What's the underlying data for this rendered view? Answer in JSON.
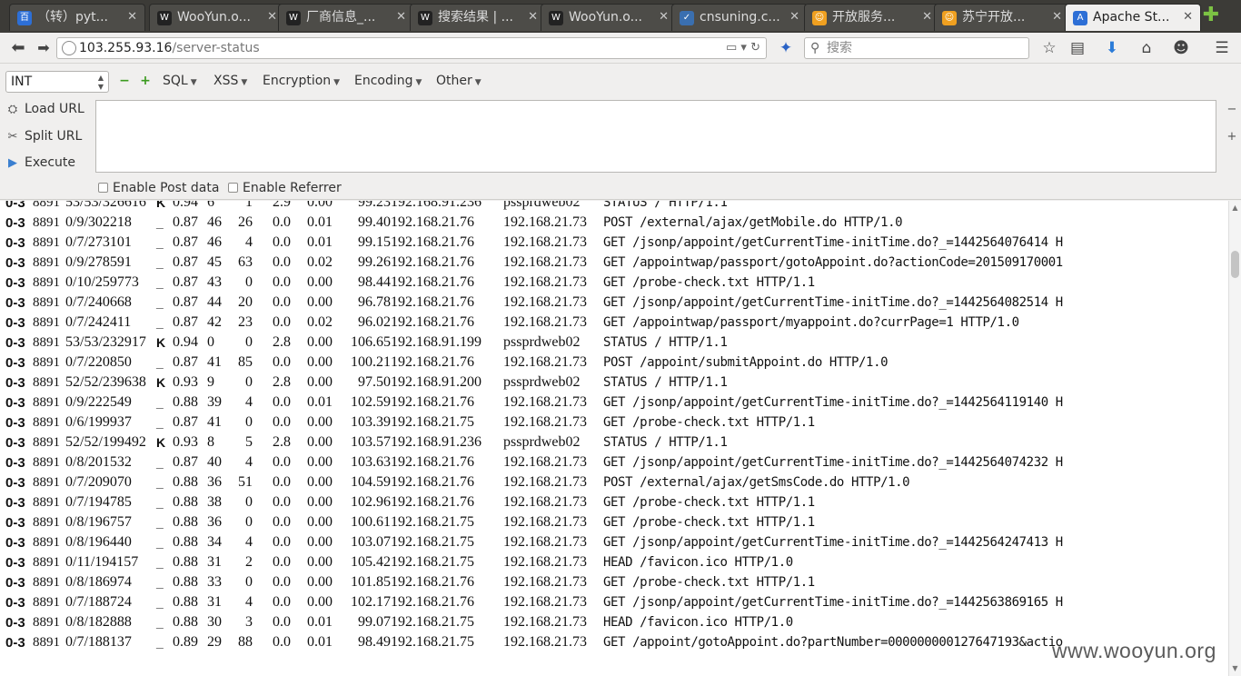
{
  "tabs": [
    {
      "title": "（转）pyt...",
      "icon": "baidu-icon",
      "color": "#2d6fd6",
      "glyph": "百"
    },
    {
      "title": "WooYun.o...",
      "icon": "wooyun-icon",
      "color": "#222222",
      "glyph": "W"
    },
    {
      "title": "厂商信息_...",
      "icon": "wooyun-icon",
      "color": "#222222",
      "glyph": "W"
    },
    {
      "title": "搜索结果 | ...",
      "icon": "wooyun-icon",
      "color": "#222222",
      "glyph": "W"
    },
    {
      "title": "WooYun.o...",
      "icon": "wooyun-icon",
      "color": "#222222",
      "glyph": "W"
    },
    {
      "title": "cnsuning.c...",
      "icon": "cnsuning-icon",
      "color": "#3a6fb0",
      "glyph": "✓"
    },
    {
      "title": "开放服务...",
      "icon": "suning-icon",
      "color": "#f0a020",
      "glyph": "☺"
    },
    {
      "title": "苏宁开放...",
      "icon": "suning-icon",
      "color": "#f0a020",
      "glyph": "☺"
    },
    {
      "title": "Apache St...",
      "icon": "apache-status-icon",
      "color": "#2d6fd6",
      "glyph": "A",
      "active": true
    }
  ],
  "nav": {
    "url_host": "103.255.93.16",
    "url_path": "/server-status",
    "search_placeholder": "搜索"
  },
  "hackbar": {
    "select_value": "INT",
    "menus": [
      "SQL",
      "XSS",
      "Encryption",
      "Encoding",
      "Other"
    ],
    "load_url": "Load URL",
    "split_url": "Split URL",
    "execute": "Execute",
    "enable_post": "Enable Post data",
    "enable_referrer": "Enable Referrer"
  },
  "rows": [
    [
      "0-3",
      "8891",
      "53/53/326616",
      "K",
      "0.94",
      "6",
      "1",
      "2.9",
      "0.00",
      "99.23",
      "192.168.91.236",
      "pssprdweb02",
      "STATUS / HTTP/1.1"
    ],
    [
      "0-3",
      "8891",
      "0/9/302218",
      "_",
      "0.87",
      "46",
      "26",
      "0.0",
      "0.01",
      "99.40",
      "192.168.21.76",
      "192.168.21.73",
      "POST /external/ajax/getMobile.do HTTP/1.0"
    ],
    [
      "0-3",
      "8891",
      "0/7/273101",
      "_",
      "0.87",
      "46",
      "4",
      "0.0",
      "0.01",
      "99.15",
      "192.168.21.76",
      "192.168.21.73",
      "GET /jsonp/appoint/getCurrentTime-initTime.do?_=1442564076414 H"
    ],
    [
      "0-3",
      "8891",
      "0/9/278591",
      "_",
      "0.87",
      "45",
      "63",
      "0.0",
      "0.02",
      "99.26",
      "192.168.21.76",
      "192.168.21.73",
      "GET /appointwap/passport/gotoAppoint.do?actionCode=201509170001"
    ],
    [
      "0-3",
      "8891",
      "0/10/259773",
      "_",
      "0.87",
      "43",
      "0",
      "0.0",
      "0.00",
      "98.44",
      "192.168.21.76",
      "192.168.21.73",
      "GET /probe-check.txt HTTP/1.1"
    ],
    [
      "0-3",
      "8891",
      "0/7/240668",
      "_",
      "0.87",
      "44",
      "20",
      "0.0",
      "0.00",
      "96.78",
      "192.168.21.76",
      "192.168.21.73",
      "GET /jsonp/appoint/getCurrentTime-initTime.do?_=1442564082514 H"
    ],
    [
      "0-3",
      "8891",
      "0/7/242411",
      "_",
      "0.87",
      "42",
      "23",
      "0.0",
      "0.02",
      "96.02",
      "192.168.21.76",
      "192.168.21.73",
      "GET /appointwap/passport/myappoint.do?currPage=1 HTTP/1.0"
    ],
    [
      "0-3",
      "8891",
      "53/53/232917",
      "K",
      "0.94",
      "0",
      "0",
      "2.8",
      "0.00",
      "106.65",
      "192.168.91.199",
      "pssprdweb02",
      "STATUS / HTTP/1.1"
    ],
    [
      "0-3",
      "8891",
      "0/7/220850",
      "_",
      "0.87",
      "41",
      "85",
      "0.0",
      "0.00",
      "100.21",
      "192.168.21.76",
      "192.168.21.73",
      "POST /appoint/submitAppoint.do HTTP/1.0"
    ],
    [
      "0-3",
      "8891",
      "52/52/239638",
      "K",
      "0.93",
      "9",
      "0",
      "2.8",
      "0.00",
      "97.50",
      "192.168.91.200",
      "pssprdweb02",
      "STATUS / HTTP/1.1"
    ],
    [
      "0-3",
      "8891",
      "0/9/222549",
      "_",
      "0.88",
      "39",
      "4",
      "0.0",
      "0.01",
      "102.59",
      "192.168.21.76",
      "192.168.21.73",
      "GET /jsonp/appoint/getCurrentTime-initTime.do?_=1442564119140 H"
    ],
    [
      "0-3",
      "8891",
      "0/6/199937",
      "_",
      "0.87",
      "41",
      "0",
      "0.0",
      "0.00",
      "103.39",
      "192.168.21.75",
      "192.168.21.73",
      "GET /probe-check.txt HTTP/1.1"
    ],
    [
      "0-3",
      "8891",
      "52/52/199492",
      "K",
      "0.93",
      "8",
      "5",
      "2.8",
      "0.00",
      "103.57",
      "192.168.91.236",
      "pssprdweb02",
      "STATUS / HTTP/1.1"
    ],
    [
      "0-3",
      "8891",
      "0/8/201532",
      "_",
      "0.87",
      "40",
      "4",
      "0.0",
      "0.00",
      "103.63",
      "192.168.21.76",
      "192.168.21.73",
      "GET /jsonp/appoint/getCurrentTime-initTime.do?_=1442564074232 H"
    ],
    [
      "0-3",
      "8891",
      "0/7/209070",
      "_",
      "0.88",
      "36",
      "51",
      "0.0",
      "0.00",
      "104.59",
      "192.168.21.76",
      "192.168.21.73",
      "POST /external/ajax/getSmsCode.do HTTP/1.0"
    ],
    [
      "0-3",
      "8891",
      "0/7/194785",
      "_",
      "0.88",
      "38",
      "0",
      "0.0",
      "0.00",
      "102.96",
      "192.168.21.76",
      "192.168.21.73",
      "GET /probe-check.txt HTTP/1.1"
    ],
    [
      "0-3",
      "8891",
      "0/8/196757",
      "_",
      "0.88",
      "36",
      "0",
      "0.0",
      "0.00",
      "100.61",
      "192.168.21.75",
      "192.168.21.73",
      "GET /probe-check.txt HTTP/1.1"
    ],
    [
      "0-3",
      "8891",
      "0/8/196440",
      "_",
      "0.88",
      "34",
      "4",
      "0.0",
      "0.00",
      "103.07",
      "192.168.21.75",
      "192.168.21.73",
      "GET /jsonp/appoint/getCurrentTime-initTime.do?_=1442564247413 H"
    ],
    [
      "0-3",
      "8891",
      "0/11/194157",
      "_",
      "0.88",
      "31",
      "2",
      "0.0",
      "0.00",
      "105.42",
      "192.168.21.75",
      "192.168.21.73",
      "HEAD /favicon.ico HTTP/1.0"
    ],
    [
      "0-3",
      "8891",
      "0/8/186974",
      "_",
      "0.88",
      "33",
      "0",
      "0.0",
      "0.00",
      "101.85",
      "192.168.21.76",
      "192.168.21.73",
      "GET /probe-check.txt HTTP/1.1"
    ],
    [
      "0-3",
      "8891",
      "0/7/188724",
      "_",
      "0.88",
      "31",
      "4",
      "0.0",
      "0.00",
      "102.17",
      "192.168.21.76",
      "192.168.21.73",
      "GET /jsonp/appoint/getCurrentTime-initTime.do?_=1442563869165 H"
    ],
    [
      "0-3",
      "8891",
      "0/8/182888",
      "_",
      "0.88",
      "30",
      "3",
      "0.0",
      "0.01",
      "99.07",
      "192.168.21.75",
      "192.168.21.73",
      "HEAD /favicon.ico HTTP/1.0"
    ],
    [
      "0-3",
      "8891",
      "0/7/188137",
      "_",
      "0.89",
      "29",
      "88",
      "0.0",
      "0.01",
      "98.49",
      "192.168.21.75",
      "192.168.21.73",
      "GET /appoint/gotoAppoint.do?partNumber=000000000127647193&actio"
    ]
  ],
  "watermark": "www.wooyun.org"
}
